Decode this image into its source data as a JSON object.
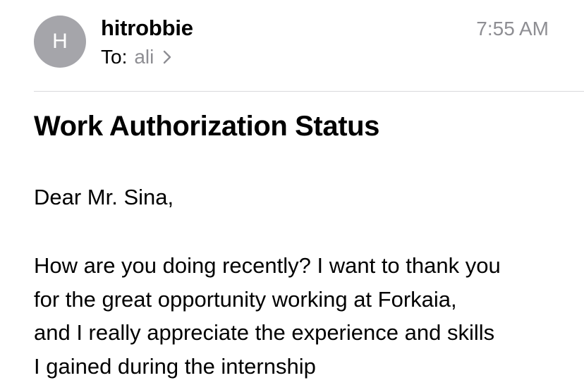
{
  "header": {
    "avatar_initial": "H",
    "sender": "hitrobbie",
    "time": "7:55 AM",
    "to_label": "To:",
    "recipient": "ali",
    "chevron_icon": "chevron-right-icon",
    "avatar_color": "#a5a5aa",
    "secondary_text_color": "#8e8e93"
  },
  "message": {
    "subject": "Work Authorization Status",
    "greeting": "Dear Mr. Sina,",
    "body_lines": [
      "How are you doing recently? I want to thank you",
      "for the great opportunity working at Forkaia,",
      "and I really appreciate the experience and skills",
      "I gained during the internship"
    ]
  }
}
